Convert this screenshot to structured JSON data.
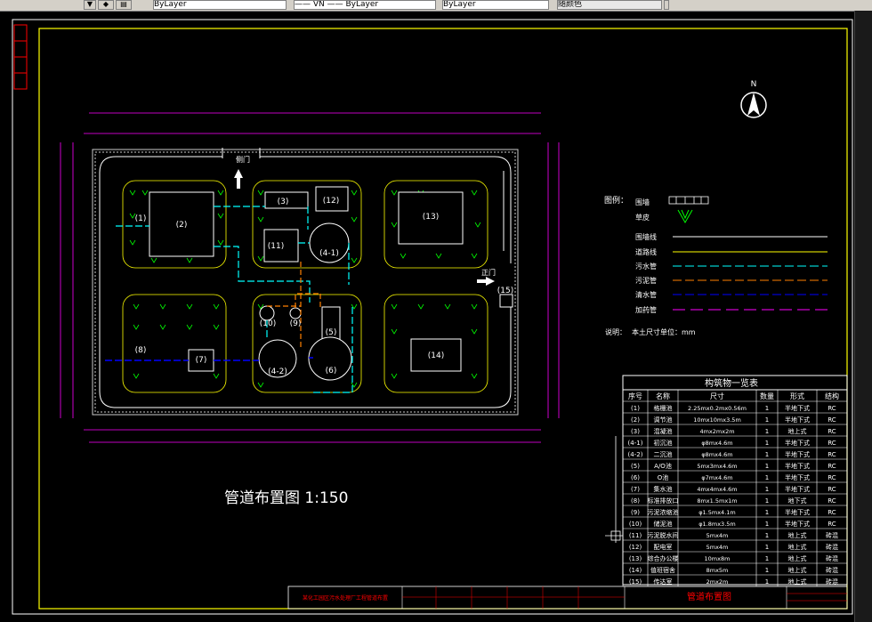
{
  "toolbar": {
    "layer_value": "ByLayer",
    "linetype_value": "ByLayer",
    "lineweight_value": "ByLayer",
    "color_value": "随颜色",
    "linetype_prefix": "—— VN ——"
  },
  "drawing": {
    "title": "管道布置图  1:150",
    "north": "N",
    "gate_side": "侧门",
    "gate_main": "正门",
    "title_block_left": "某化工园区污水处理厂工程管道布置",
    "title_block_mid": "管道布置图"
  },
  "legend": {
    "heading": "图例：",
    "items": [
      {
        "label": "围墙",
        "sym": "wall"
      },
      {
        "label": "草皮",
        "sym": "grass"
      },
      {
        "label": "围墙线",
        "sym": "line",
        "color": "#ffffff"
      },
      {
        "label": "道路线",
        "sym": "line",
        "color": "#ffff00"
      },
      {
        "label": "污水管",
        "sym": "dash",
        "color": "#00ffff"
      },
      {
        "label": "污泥管",
        "sym": "dash",
        "color": "#ff8000"
      },
      {
        "label": "清水管",
        "sym": "dash",
        "color": "#0000ff"
      },
      {
        "label": "加药管",
        "sym": "dash",
        "color": "#ff00ff"
      }
    ],
    "note_label": "说明：",
    "note_text": "本土尺寸单位：mm"
  },
  "table": {
    "title": "构筑物一览表",
    "headers": [
      "序号",
      "名称",
      "尺寸",
      "数量",
      "形式",
      "结构"
    ],
    "rows": [
      [
        "(1)",
        "格栅池",
        "2.25mx0.2mx0.56m",
        "1",
        "半地下式",
        "RC"
      ],
      [
        "(2)",
        "调节池",
        "10mx10mx3.5m",
        "1",
        "半地下式",
        "RC"
      ],
      [
        "(3)",
        "混凝池",
        "4mx2mx2m",
        "1",
        "地上式",
        "RC"
      ],
      [
        "(4-1)",
        "初沉池",
        "φ8mx4.6m",
        "1",
        "半地下式",
        "RC"
      ],
      [
        "(4-2)",
        "二沉池",
        "φ8mx4.6m",
        "1",
        "半地下式",
        "RC"
      ],
      [
        "(5)",
        "A/O池",
        "5mx3mx4.6m",
        "1",
        "半地下式",
        "RC"
      ],
      [
        "(6)",
        "O池",
        "φ7mx4.6m",
        "1",
        "半地下式",
        "RC"
      ],
      [
        "(7)",
        "集水池",
        "4mx4mx4.6m",
        "1",
        "半地下式",
        "RC"
      ],
      [
        "(8)",
        "标准排放口",
        "8mx1.5mx1m",
        "1",
        "地下式",
        "RC"
      ],
      [
        "(9)",
        "污泥浓缩池",
        "φ1.5mx4.1m",
        "1",
        "半地下式",
        "RC"
      ],
      [
        "(10)",
        "储泥池",
        "φ1.8mx3.5m",
        "1",
        "半地下式",
        "RC"
      ],
      [
        "(11)",
        "污泥脱水间",
        "5mx4m",
        "1",
        "地上式",
        "砖混"
      ],
      [
        "(12)",
        "配电室",
        "5mx4m",
        "1",
        "地上式",
        "砖混"
      ],
      [
        "(13)",
        "综合办公楼",
        "10mx8m",
        "1",
        "地上式",
        "砖混"
      ],
      [
        "(14)",
        "值班宿舍",
        "8mx5m",
        "1",
        "地上式",
        "砖混"
      ],
      [
        "(15)",
        "传达室",
        "2mx2m",
        "1",
        "地上式",
        "砖混"
      ]
    ]
  },
  "plan_labels": {
    "b1": "(1)",
    "b2": "(2)",
    "b3": "(3)",
    "b11": "(11)",
    "b12": "(12)",
    "b41": "(4-1)",
    "b13": "(13)",
    "b10": "(10)",
    "b9": "(9)",
    "b5": "(5)",
    "b42": "(4-2)",
    "b6": "(6)",
    "b8": "(8)",
    "b7": "(7)",
    "b14": "(14)",
    "b15": "(15)"
  }
}
